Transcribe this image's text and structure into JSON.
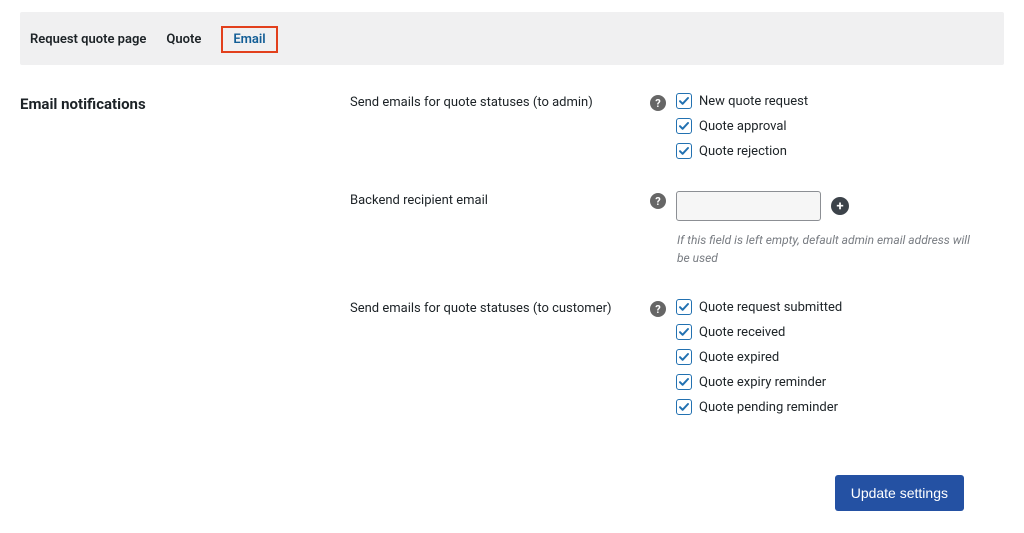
{
  "tabs": {
    "request_quote_page": "Request quote page",
    "quote": "Quote",
    "email": "Email"
  },
  "section": {
    "title": "Email notifications"
  },
  "fields": {
    "admin_statuses": {
      "label": "Send emails for quote statuses (to admin)",
      "options": [
        {
          "label": "New quote request",
          "checked": true
        },
        {
          "label": "Quote approval",
          "checked": true
        },
        {
          "label": "Quote rejection",
          "checked": true
        }
      ]
    },
    "backend_email": {
      "label": "Backend recipient email",
      "value": "",
      "hint": "If this field is left empty, default admin email address will be used"
    },
    "customer_statuses": {
      "label": "Send emails for quote statuses (to customer)",
      "options": [
        {
          "label": "Quote request submitted",
          "checked": true
        },
        {
          "label": "Quote received",
          "checked": true
        },
        {
          "label": "Quote expired",
          "checked": true
        },
        {
          "label": "Quote expiry reminder",
          "checked": true
        },
        {
          "label": "Quote pending reminder",
          "checked": true
        }
      ]
    }
  },
  "footer": {
    "update_button": "Update settings"
  }
}
